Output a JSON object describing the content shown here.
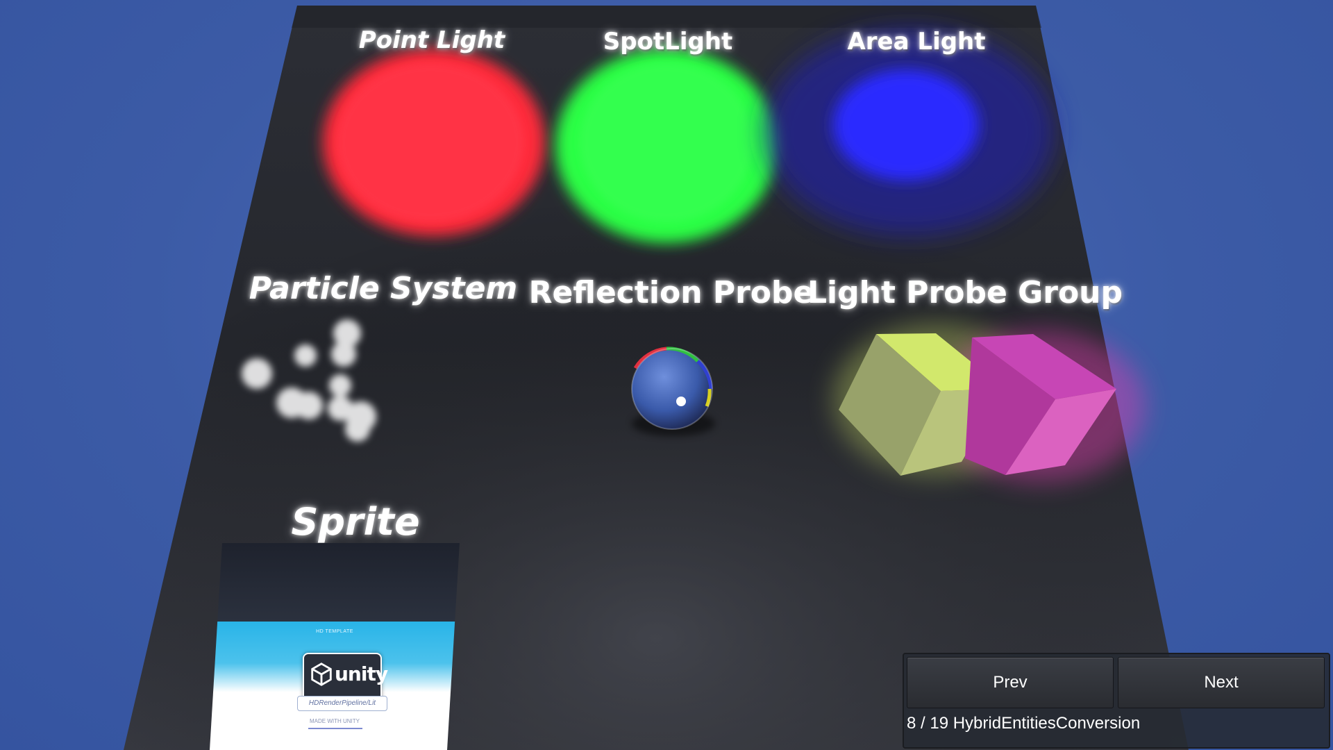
{
  "scene": {
    "labels": {
      "point_light": "Point Light",
      "spot_light": "SpotLight",
      "area_light": "Area Light",
      "particle_system": "Particle System",
      "reflection_probe": "Reflection Probe",
      "light_probe_group": "Light Probe Group",
      "sprite": "Sprite"
    },
    "light_colors": {
      "point": "#ff2a3a",
      "spot": "#2cff45",
      "area": "#2a2cff",
      "yellow_cube": "#d8ec6a",
      "magenta_cube": "#e040b0"
    },
    "sprite_card": {
      "header_text": "HD TEMPLATE",
      "logo_text": "unity",
      "subtitle": "HDRenderPipeline/Lit",
      "footer_text": "MADE WITH UNITY"
    }
  },
  "ui": {
    "prev_label": "Prev",
    "next_label": "Next",
    "status": "8 / 19 HybridEntitiesConversion"
  }
}
